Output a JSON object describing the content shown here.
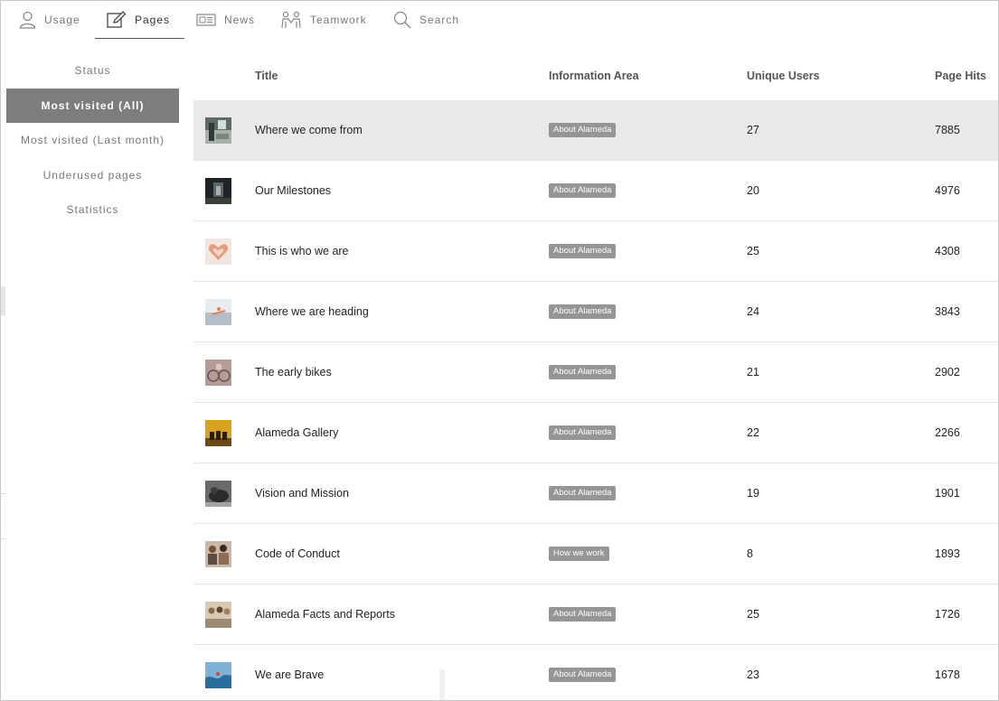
{
  "nav": {
    "tabs": [
      {
        "label": "Usage",
        "icon": "user-icon"
      },
      {
        "label": "Pages",
        "icon": "edit-icon",
        "active": true
      },
      {
        "label": "News",
        "icon": "newspaper-icon"
      },
      {
        "label": "Teamwork",
        "icon": "people-icon"
      },
      {
        "label": "Search",
        "icon": "search-icon"
      }
    ]
  },
  "sidebar": {
    "items": [
      {
        "label": "Status"
      },
      {
        "label": "Most visited (All)",
        "active": true
      },
      {
        "label": "Most visited (Last month)"
      },
      {
        "label": "Underused pages"
      },
      {
        "label": "Statistics"
      }
    ]
  },
  "table": {
    "headers": {
      "title": "Title",
      "area": "Information Area",
      "users": "Unique Users",
      "hits": "Page Hits"
    },
    "rows": [
      {
        "title": "Where we come from",
        "area": "About Alameda",
        "users": "27",
        "hits": "7885",
        "thumb": "building-photo"
      },
      {
        "title": "Our Milestones",
        "area": "About Alameda",
        "users": "20",
        "hits": "4976",
        "thumb": "corridor-photo"
      },
      {
        "title": "This is who we are",
        "area": "About Alameda",
        "users": "25",
        "hits": "4308",
        "thumb": "heart-hands-photo"
      },
      {
        "title": "Where we are heading",
        "area": "About Alameda",
        "users": "24",
        "hits": "3843",
        "thumb": "surfer-photo"
      },
      {
        "title": "The early bikes",
        "area": "About Alameda",
        "users": "21",
        "hits": "2902",
        "thumb": "bikes-photo"
      },
      {
        "title": "Alameda Gallery",
        "area": "About Alameda",
        "users": "22",
        "hits": "2266",
        "thumb": "gallery-photo"
      },
      {
        "title": "Vision and Mission",
        "area": "About Alameda",
        "users": "19",
        "hits": "1901",
        "thumb": "sculpture-photo"
      },
      {
        "title": "Code of Conduct",
        "area": "How we work",
        "users": "8",
        "hits": "1893",
        "thumb": "team-photo"
      },
      {
        "title": "Alameda Facts and Reports",
        "area": "About Alameda",
        "users": "25",
        "hits": "1726",
        "thumb": "meeting-photo"
      },
      {
        "title": "We are Brave",
        "area": "About Alameda",
        "users": "23",
        "hits": "1678",
        "thumb": "wave-photo"
      }
    ]
  },
  "colors": {
    "active_sidebar": "#7d7d7d",
    "badge": "#959595",
    "highlight_row": "#e9e9e9"
  }
}
